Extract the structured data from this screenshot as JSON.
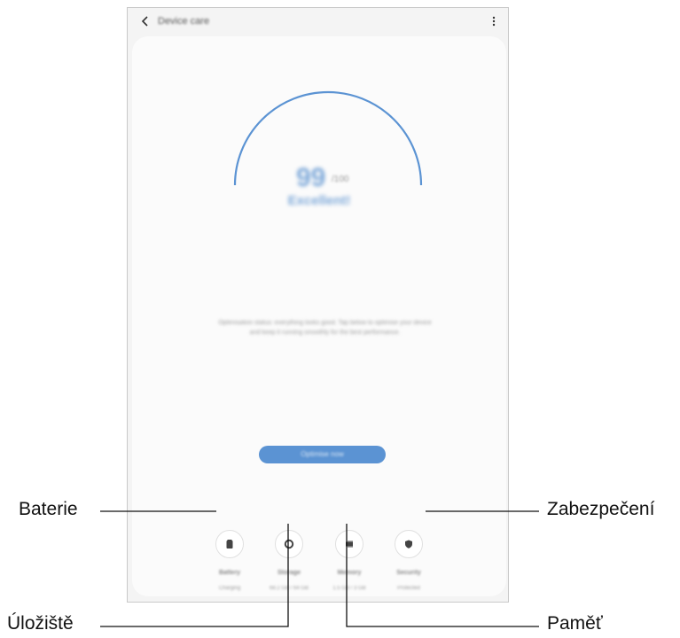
{
  "screen": {
    "title": "Device care",
    "score": "99",
    "score_max": "/100",
    "status": "Excellent!",
    "description": "Optimisation status: everything looks good. Tap below to optimise your device and keep it running smoothly for the best performance.",
    "optimize_button": "Optimise now"
  },
  "categories": [
    {
      "label": "Battery",
      "value": "Charging"
    },
    {
      "label": "Storage",
      "value": "68.2 GB / 64 GB"
    },
    {
      "label": "Memory",
      "value": "1.5 GB / 3 GB"
    },
    {
      "label": "Security",
      "value": "Protected"
    }
  ],
  "callouts": {
    "battery": "Baterie",
    "storage": "Úložiště",
    "memory": "Paměť",
    "security": "Zabezpečení"
  },
  "colors": {
    "accent": "#5b93d3",
    "gauge": "#5b93d3",
    "line": "#111111"
  },
  "icons": [
    "back-icon",
    "more-icon",
    "battery-icon",
    "storage-icon",
    "memory-icon",
    "security-icon"
  ]
}
